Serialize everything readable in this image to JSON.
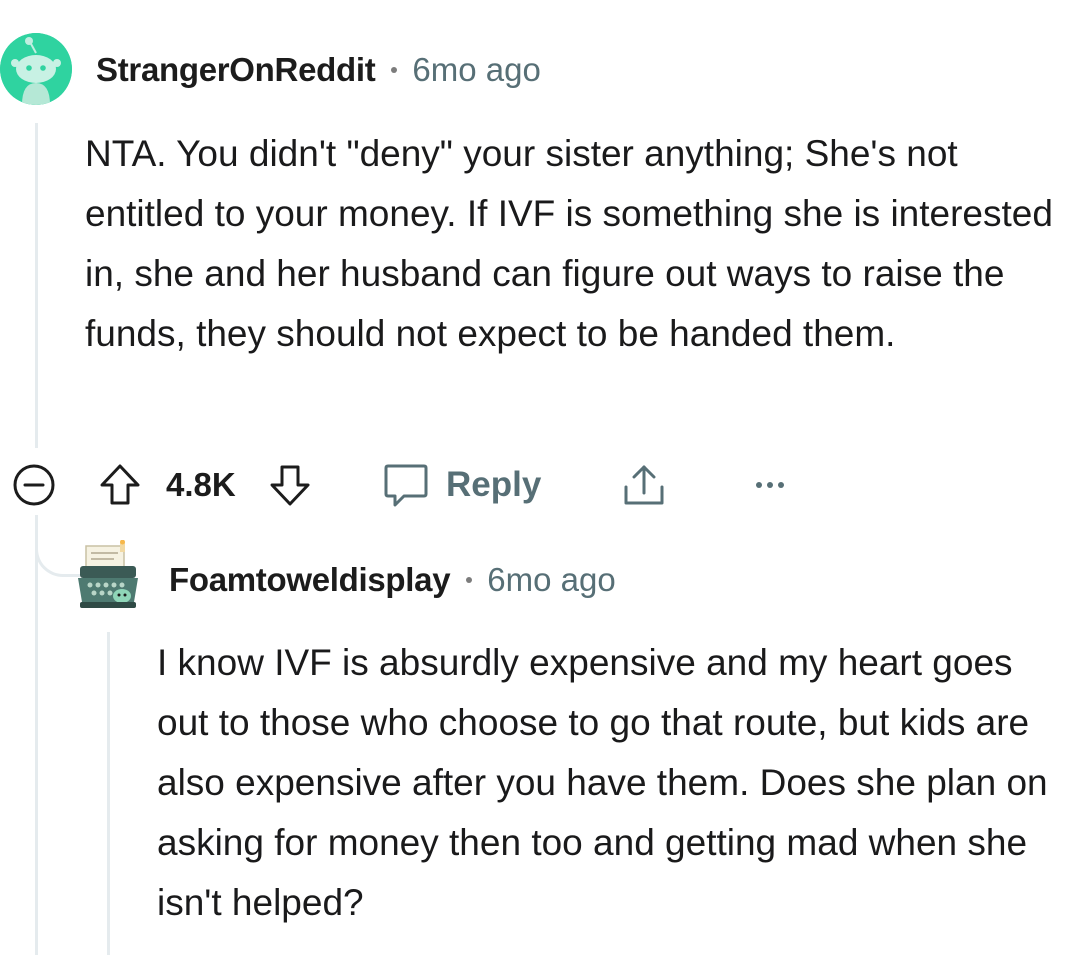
{
  "comments": [
    {
      "username": "StrangerOnReddit",
      "timestamp": "6mo ago",
      "avatar_icon": "snoo-avatar-icon",
      "body": "NTA. You didn't \"deny\" your sister anything; She's not entitled to your money. If IVF is something she is interested in, she and her husband can figure out ways to raise the funds, they should not expect to be handed them.",
      "actions": {
        "collapse_icon": "collapse-minus-icon",
        "upvote_icon": "upvote-arrow-icon",
        "vote_count": "4.8K",
        "downvote_icon": "downvote-arrow-icon",
        "reply_icon": "speech-bubble-icon",
        "reply_label": "Reply",
        "share_icon": "share-upload-icon",
        "more_icon": "more-dots-icon"
      }
    },
    {
      "username": "Foamtoweldisplay",
      "timestamp": "6mo ago",
      "avatar_icon": "typewriter-avatar-icon",
      "body": "I know IVF is absurdly expensive and my heart goes out to those who choose to go that route, but kids are also expensive after you have them. Does she plan on asking for money then too and getting mad when she isn't helped?"
    }
  ],
  "colors": {
    "avatar_green": "#2fd3a0",
    "meta_gray": "#576f76",
    "thread_line": "#e5ebee",
    "text": "#1a1a1b"
  }
}
